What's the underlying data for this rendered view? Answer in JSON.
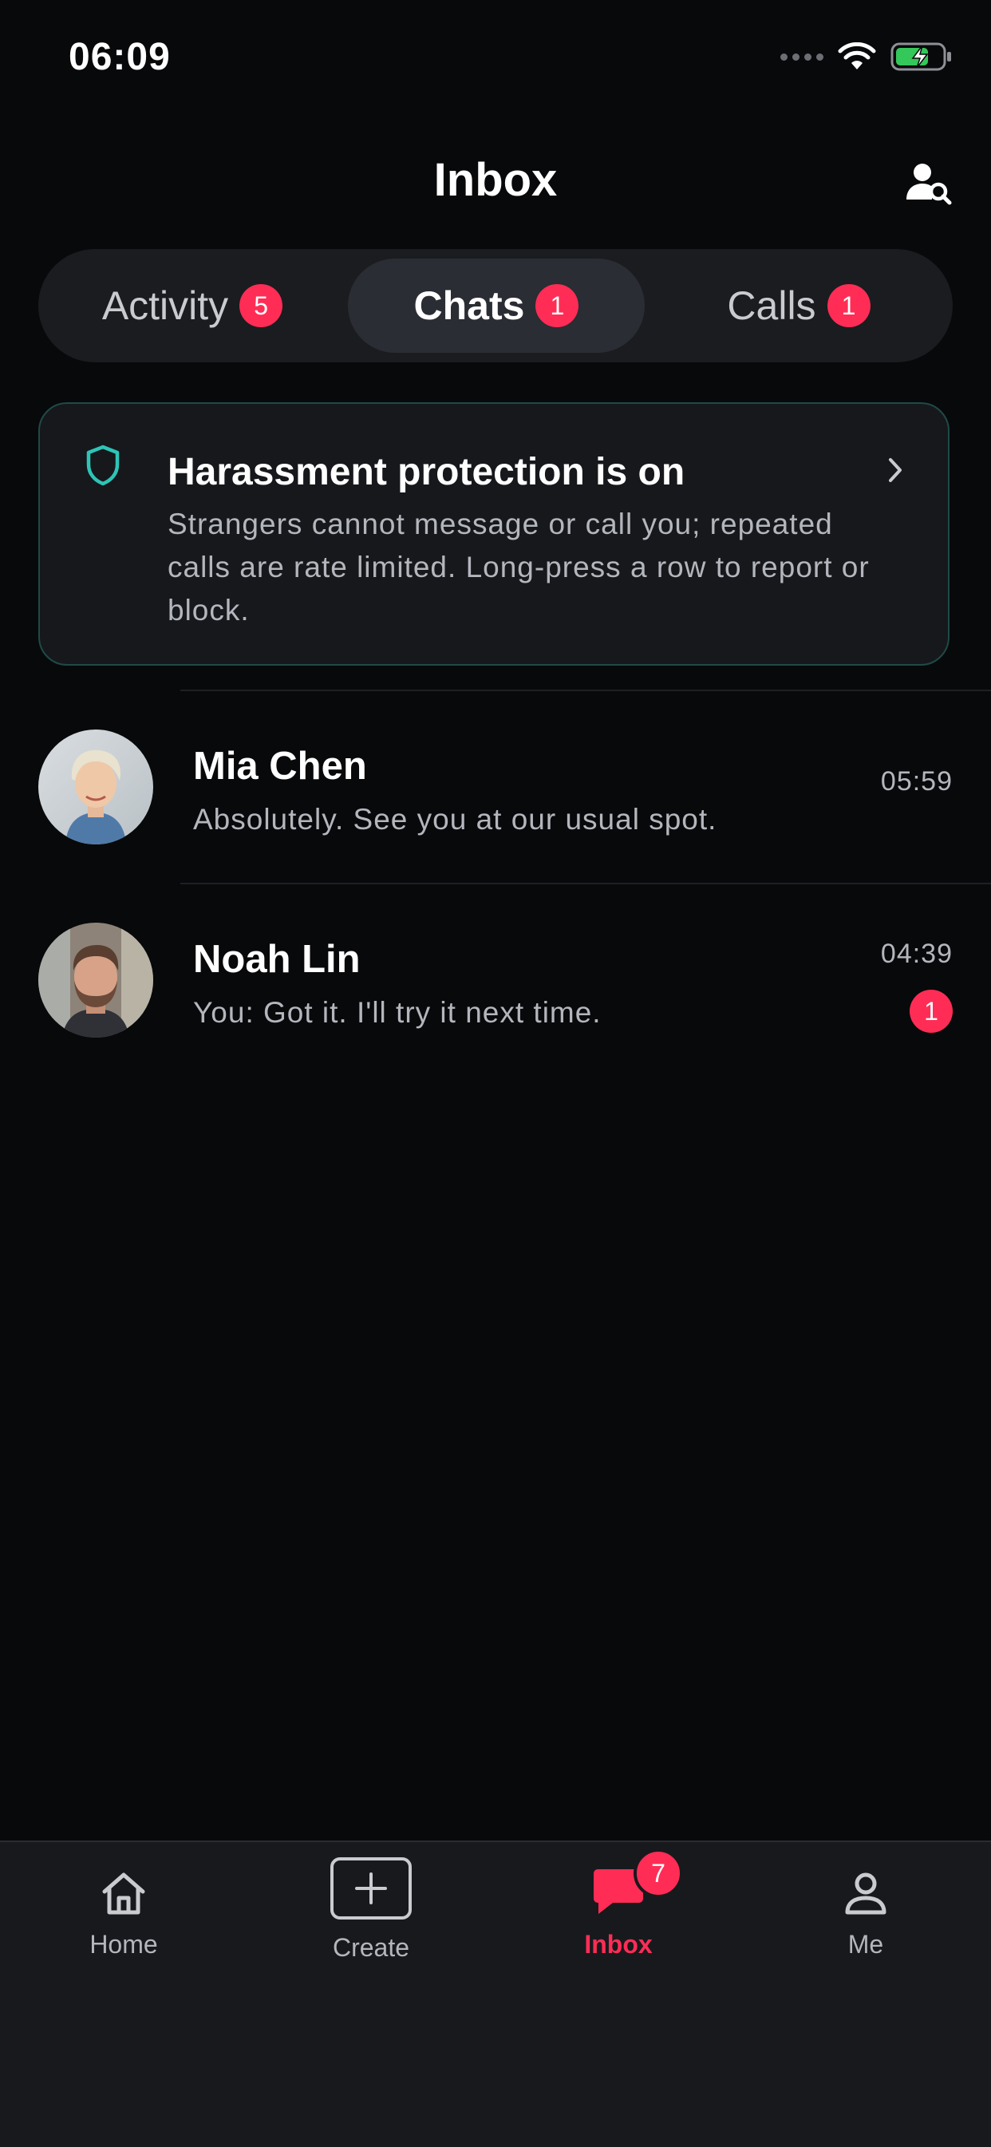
{
  "status_bar": {
    "time": "06:09"
  },
  "header": {
    "title": "Inbox",
    "search_icon": "user-search-icon"
  },
  "tabs": [
    {
      "label": "Activity",
      "count": "5",
      "active": false
    },
    {
      "label": "Chats",
      "count": "1",
      "active": true
    },
    {
      "label": "Calls",
      "count": "1",
      "active": false
    }
  ],
  "protection_card": {
    "title": "Harassment protection is on",
    "body": "Strangers cannot message or call you; repeated calls are rate limited. Long-press a row to report or block.",
    "accent": "#2ec4b6"
  },
  "chats": [
    {
      "name": "Mia Chen",
      "message": "Absolutely. See you at our usual spot.",
      "time": "05:59",
      "unread": ""
    },
    {
      "name": "Noah Lin",
      "message": "You: Got it. I'll try it next time.",
      "time": "04:39",
      "unread": "1"
    }
  ],
  "bottom_nav": [
    {
      "label": "Home",
      "icon": "home-icon"
    },
    {
      "label": "Create",
      "icon": "plus-box-icon"
    },
    {
      "label": "Inbox",
      "icon": "chat-bubble-icon",
      "badge": "7",
      "active": true
    },
    {
      "label": "Me",
      "icon": "person-icon"
    }
  ],
  "colors": {
    "accent": "#ff2d55",
    "background": "#08090b"
  }
}
